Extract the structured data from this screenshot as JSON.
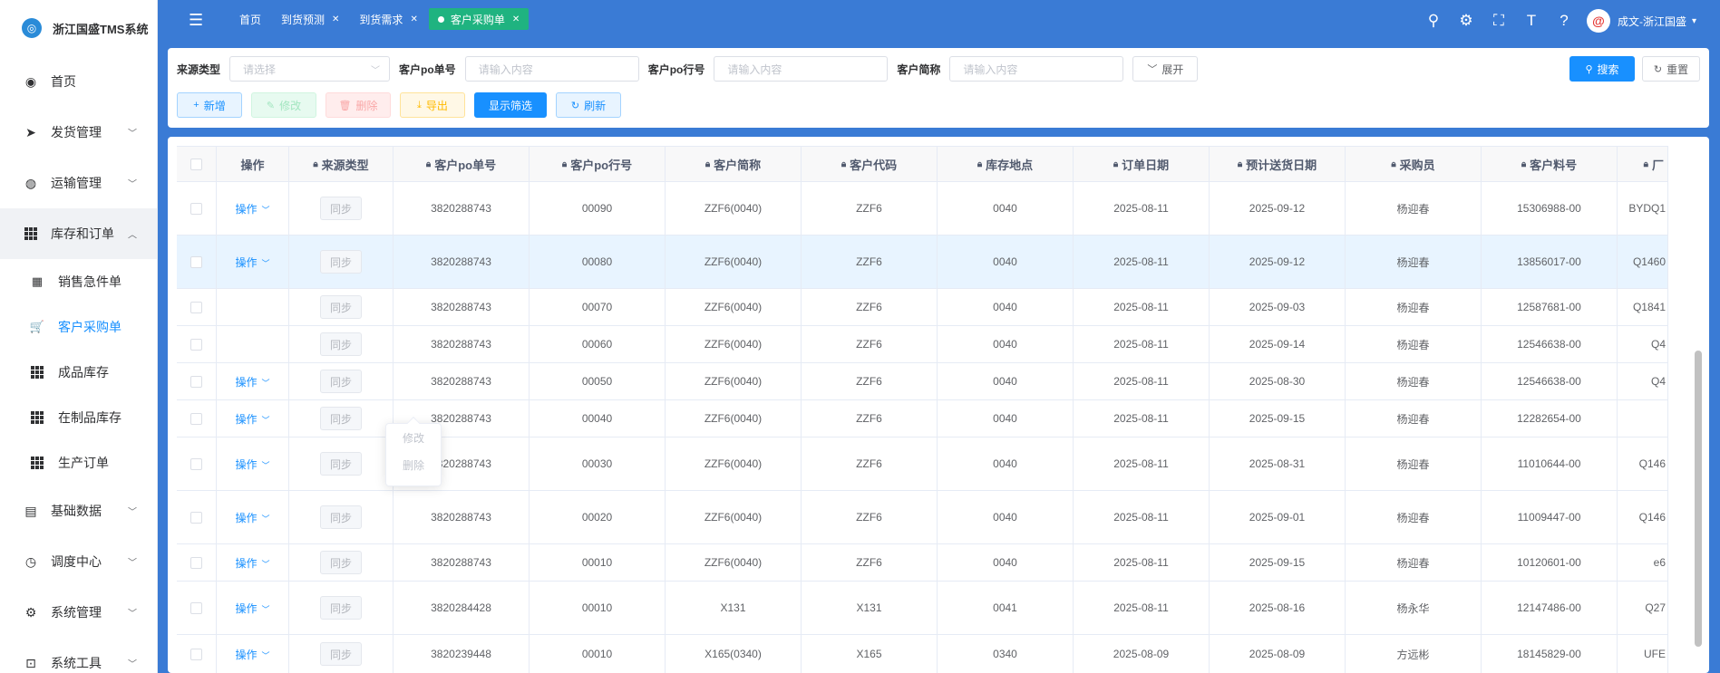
{
  "app_title": "浙江国盛TMS系统",
  "sidebar": {
    "items": [
      {
        "label": "首页",
        "icon": "dashboard-icon"
      },
      {
        "label": "发货管理",
        "icon": "send-icon"
      },
      {
        "label": "运输管理",
        "icon": "globe-icon"
      },
      {
        "label": "库存和订单",
        "icon": "table-icon"
      },
      {
        "label": "销售急件单",
        "icon": "calculator-icon"
      },
      {
        "label": "客户采购单",
        "icon": "cart-icon"
      },
      {
        "label": "成品库存",
        "icon": "table-icon"
      },
      {
        "label": "在制品库存",
        "icon": "table-icon"
      },
      {
        "label": "生产订单",
        "icon": "table-icon"
      },
      {
        "label": "基础数据",
        "icon": "book-icon"
      },
      {
        "label": "调度中心",
        "icon": "clock-icon"
      },
      {
        "label": "系统管理",
        "icon": "gear-icon"
      },
      {
        "label": "系统工具",
        "icon": "toolbox-icon"
      }
    ]
  },
  "tabs": [
    {
      "label": "首页"
    },
    {
      "label": "到货预测"
    },
    {
      "label": "到货需求"
    },
    {
      "label": "客户采购单"
    }
  ],
  "user": {
    "name": "成文-浙江国盛"
  },
  "filters": {
    "source_type_label": "来源类型",
    "source_type_placeholder": "请选择",
    "po_no_label": "客户po单号",
    "po_no_placeholder": "请输入内容",
    "po_line_label": "客户po行号",
    "po_line_placeholder": "请输入内容",
    "short_name_label": "客户简称",
    "short_name_placeholder": "请输入内容",
    "expand_label": "展开",
    "search_label": "搜索",
    "reset_label": "重置"
  },
  "toolbar": {
    "add": "新增",
    "edit": "修改",
    "delete": "删除",
    "export": "导出",
    "show_filter": "显示筛选",
    "refresh": "刷新"
  },
  "table": {
    "columns": [
      "操作",
      "来源类型",
      "客户po单号",
      "客户po行号",
      "客户简称",
      "客户代码",
      "库存地点",
      "订单日期",
      "预计送货日期",
      "采购员",
      "客户料号",
      "厂"
    ],
    "op_label": "操作",
    "sync_label": "同步",
    "rows": [
      {
        "op": "操作",
        "po": "3820288743",
        "line": "00090",
        "short": "ZZF6(0040)",
        "code": "ZZF6",
        "loc": "0040",
        "order_date": "2025-08-11",
        "eta": "2025-09-12",
        "buyer": "杨迎春",
        "part": "15306988-00",
        "extra": "BYDQ1"
      },
      {
        "op": "操作",
        "po": "3820288743",
        "line": "00080",
        "short": "ZZF6(0040)",
        "code": "ZZF6",
        "loc": "0040",
        "order_date": "2025-08-11",
        "eta": "2025-09-12",
        "buyer": "杨迎春",
        "part": "13856017-00",
        "extra": "Q1460"
      },
      {
        "op": "",
        "po": "3820288743",
        "line": "00070",
        "short": "ZZF6(0040)",
        "code": "ZZF6",
        "loc": "0040",
        "order_date": "2025-08-11",
        "eta": "2025-09-03",
        "buyer": "杨迎春",
        "part": "12587681-00",
        "extra": "Q1841"
      },
      {
        "op": "",
        "po": "3820288743",
        "line": "00060",
        "short": "ZZF6(0040)",
        "code": "ZZF6",
        "loc": "0040",
        "order_date": "2025-08-11",
        "eta": "2025-09-14",
        "buyer": "杨迎春",
        "part": "12546638-00",
        "extra": "Q4"
      },
      {
        "op": "操作",
        "po": "3820288743",
        "line": "00050",
        "short": "ZZF6(0040)",
        "code": "ZZF6",
        "loc": "0040",
        "order_date": "2025-08-11",
        "eta": "2025-08-30",
        "buyer": "杨迎春",
        "part": "12546638-00",
        "extra": "Q4"
      },
      {
        "op": "操作",
        "po": "3820288743",
        "line": "00040",
        "short": "ZZF6(0040)",
        "code": "ZZF6",
        "loc": "0040",
        "order_date": "2025-08-11",
        "eta": "2025-09-15",
        "buyer": "杨迎春",
        "part": "12282654-00",
        "extra": ""
      },
      {
        "op": "操作",
        "po": "3820288743",
        "line": "00030",
        "short": "ZZF6(0040)",
        "code": "ZZF6",
        "loc": "0040",
        "order_date": "2025-08-11",
        "eta": "2025-08-31",
        "buyer": "杨迎春",
        "part": "11010644-00",
        "extra": "Q146"
      },
      {
        "op": "操作",
        "po": "3820288743",
        "line": "00020",
        "short": "ZZF6(0040)",
        "code": "ZZF6",
        "loc": "0040",
        "order_date": "2025-08-11",
        "eta": "2025-09-01",
        "buyer": "杨迎春",
        "part": "11009447-00",
        "extra": "Q146"
      },
      {
        "op": "操作",
        "po": "3820288743",
        "line": "00010",
        "short": "ZZF6(0040)",
        "code": "ZZF6",
        "loc": "0040",
        "order_date": "2025-08-11",
        "eta": "2025-09-15",
        "buyer": "杨迎春",
        "part": "10120601-00",
        "extra": "e6"
      },
      {
        "op": "操作",
        "po": "3820284428",
        "line": "00010",
        "short": "X131",
        "code": "X131",
        "loc": "0041",
        "order_date": "2025-08-11",
        "eta": "2025-08-16",
        "buyer": "杨永华",
        "part": "12147486-00",
        "extra": "Q27"
      },
      {
        "op": "操作",
        "po": "3820239448",
        "line": "00010",
        "short": "X165(0340)",
        "code": "X165",
        "loc": "0340",
        "order_date": "2025-08-09",
        "eta": "2025-08-09",
        "buyer": "方远彬",
        "part": "18145829-00",
        "extra": "UFE"
      }
    ]
  },
  "dropdown": {
    "edit": "修改",
    "delete": "删除"
  },
  "colors": {
    "topbar": "#3a7bd5",
    "primary": "#1890ff",
    "active_tab": "#1fb380"
  }
}
